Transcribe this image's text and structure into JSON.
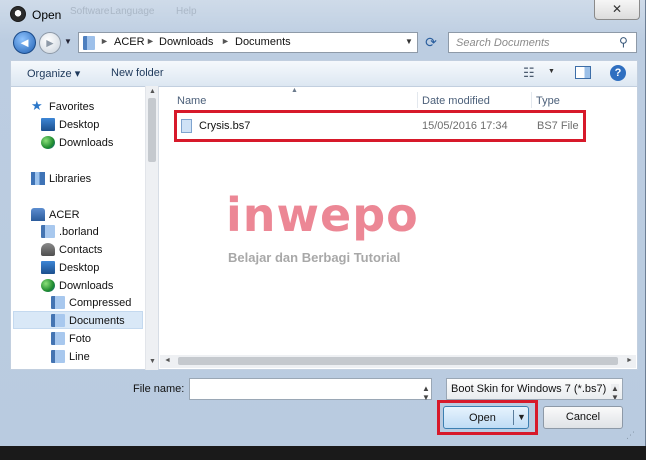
{
  "window": {
    "title": "Open",
    "close_glyph": "✕",
    "ghost_menus": [
      "Software",
      "Language",
      "Help"
    ]
  },
  "address": {
    "breadcrumbs": [
      "ACER",
      "Downloads",
      "Documents"
    ],
    "separator": "►",
    "search_placeholder": "Search Documents"
  },
  "toolbar": {
    "organize": "Organize ▾",
    "new_folder": "New folder",
    "help": "?"
  },
  "nav": {
    "favorites": "Favorites",
    "desktop_fav": "Desktop",
    "downloads_fav": "Downloads",
    "libraries": "Libraries",
    "computer": "ACER",
    "borland": ".borland",
    "contacts": "Contacts",
    "desktop": "Desktop",
    "downloads": "Downloads",
    "compressed": "Compressed",
    "documents": "Documents",
    "foto": "Foto",
    "line": "Line"
  },
  "columns": {
    "name": "Name",
    "date_modified": "Date modified",
    "type": "Type"
  },
  "files": [
    {
      "name": "Crysis.bs7",
      "date_modified": "15/05/2016 17:34",
      "type": "BS7 File"
    }
  ],
  "footer": {
    "file_name_label": "File name:",
    "file_name_value": "",
    "file_type_selected": "Boot Skin for Windows 7 (*.bs7)",
    "open_label": "Open",
    "cancel_label": "Cancel"
  },
  "watermark": {
    "logo": "inwepo",
    "tagline": "Belajar dan Berbagi Tutorial"
  },
  "colors": {
    "highlight": "#d7192a",
    "watermark_logo": "#ec8795",
    "selection": "#d9e8f7"
  }
}
